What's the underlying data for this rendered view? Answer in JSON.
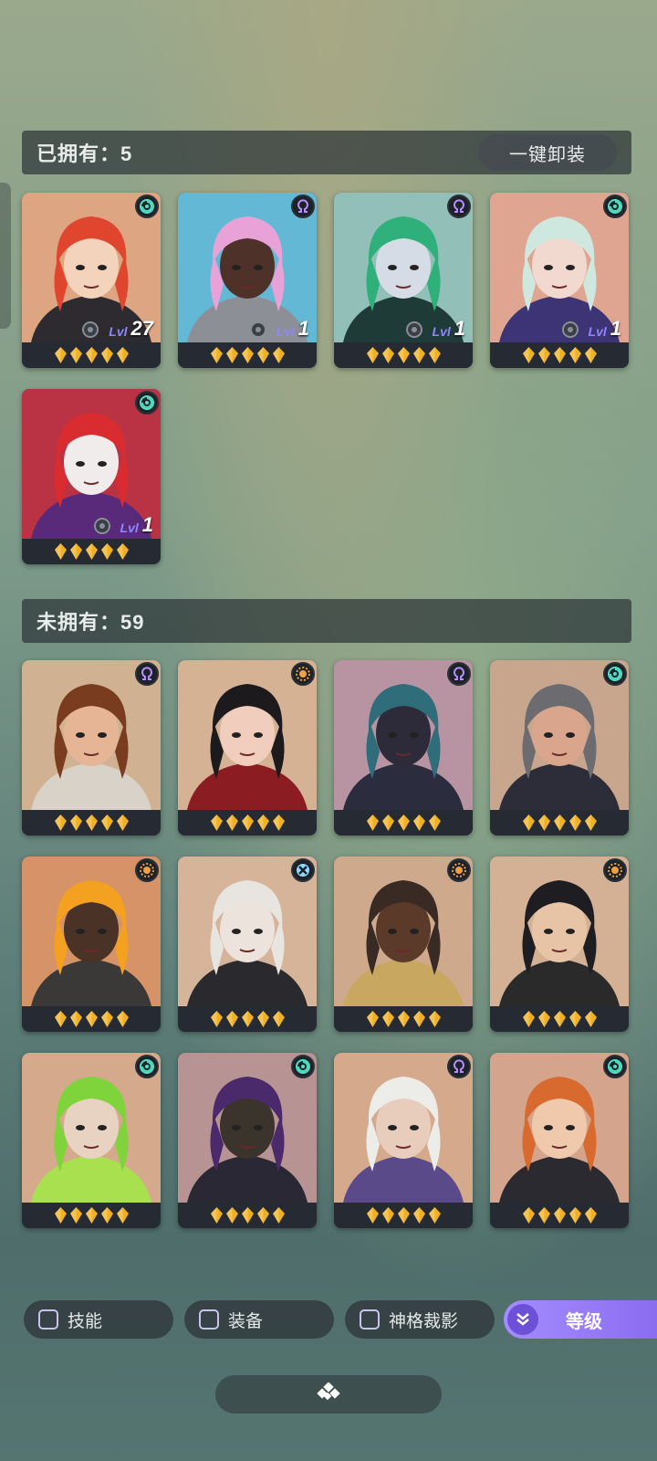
{
  "owned": {
    "title": "已拥有：5",
    "unequip_all": "一键卸装",
    "heroes": [
      {
        "name_icon": "red-hair-hero-portrait",
        "bg": "#f0b48e",
        "hair": "#e0452e",
        "skin": "#f4d3bc",
        "outfit": "#2d2a30",
        "class_icon": "swirl-icon",
        "class_color": "#4fe0c3",
        "lv_tag": "Lvl",
        "level": "27",
        "stars": 5
      },
      {
        "name_icon": "pink-hair-hero-portrait",
        "bg": "#6cc8e8",
        "hair": "#e9a2d8",
        "skin": "#4e3128",
        "outfit": "#8c8f96",
        "class_icon": "omega-icon",
        "class_color": "#b88cff",
        "lv_tag": "Lvl",
        "level": "1",
        "stars": 5
      },
      {
        "name_icon": "green-hood-hero-portrait",
        "bg": "#9fd0c8",
        "hair": "#2fb07a",
        "skin": "#d6dce6",
        "outfit": "#1e3b38",
        "class_icon": "omega-icon",
        "class_color": "#b88cff",
        "lv_tag": "Lvl",
        "level": "1",
        "stars": 5
      },
      {
        "name_icon": "maid-hero-portrait",
        "bg": "#f2b39d",
        "hair": "#cfe8df",
        "skin": "#f2d9d0",
        "outfit": "#3c3475",
        "class_icon": "swirl-icon",
        "class_color": "#4fe0c3",
        "lv_tag": "Lvl",
        "level": "1",
        "stars": 5
      },
      {
        "name_icon": "jester-hero-portrait",
        "bg": "#c9384a",
        "hair": "#d92c30",
        "skin": "#f1ecec",
        "outfit": "#5a2a7a",
        "class_icon": "swirl-icon",
        "class_color": "#4fe0c3",
        "lv_tag": "Lvl",
        "level": "1",
        "stars": 5
      }
    ]
  },
  "unowned": {
    "title": "未拥有：59",
    "heroes": [
      {
        "name_icon": "bearded-hero-portrait",
        "bg": "#e2c2a0",
        "hair": "#7a3c1e",
        "skin": "#e6b595",
        "outfit": "#d8d2c8",
        "class_icon": "omega-icon",
        "class_color": "#b88cff",
        "stars": 5
      },
      {
        "name_icon": "dark-queen-hero-portrait",
        "bg": "#e9c2a2",
        "hair": "#1c1a1c",
        "skin": "#f0cdbd",
        "outfit": "#8a1c22",
        "class_icon": "sun-icon",
        "class_color": "#f0a040",
        "stars": 5
      },
      {
        "name_icon": "goggles-hero-portrait",
        "bg": "#c8a0b0",
        "hair": "#2f6d7a",
        "skin": "#2d2b3a",
        "outfit": "#2b2d3e",
        "class_icon": "omega-icon",
        "class_color": "#b88cff",
        "stars": 5
      },
      {
        "name_icon": "sword-hero-portrait",
        "bg": "#d9b39a",
        "hair": "#6b6b70",
        "skin": "#d9a68d",
        "outfit": "#2d2d3a",
        "class_icon": "swirl-icon",
        "class_color": "#4fe0c3",
        "stars": 5
      },
      {
        "name_icon": "flame-hero-portrait",
        "bg": "#e8a070",
        "hair": "#f4a020",
        "skin": "#4a3226",
        "outfit": "#3b3838",
        "class_icon": "sun-icon",
        "class_color": "#f0a040",
        "stars": 5
      },
      {
        "name_icon": "silver-lady-hero-portrait",
        "bg": "#e8c4a8",
        "hair": "#e8e4e0",
        "skin": "#ece3dc",
        "outfit": "#2a2a2e",
        "class_icon": "cross-icon",
        "class_color": "#8fd8ff",
        "stars": 5
      },
      {
        "name_icon": "masked-hero-portrait",
        "bg": "#e0b898",
        "hair": "#3a2a24",
        "skin": "#5b3a2a",
        "outfit": "#c8a860",
        "class_icon": "sun-icon",
        "class_color": "#f0a040",
        "stars": 5
      },
      {
        "name_icon": "spiky-hero-portrait",
        "bg": "#e6c0a2",
        "hair": "#1e1e22",
        "skin": "#e8c4a6",
        "outfit": "#2a2a2a",
        "class_icon": "sun-icon",
        "class_color": "#f0a040",
        "stars": 5
      },
      {
        "name_icon": "joker-hero-portrait",
        "bg": "#e8b898",
        "hair": "#7ed43a",
        "skin": "#e8d2c2",
        "outfit": "#a8e050",
        "class_icon": "swirl-icon",
        "class_color": "#4fe0c3",
        "stars": 5
      },
      {
        "name_icon": "hooded-hero-portrait",
        "bg": "#c8a0a0",
        "hair": "#4a2a6a",
        "skin": "#3a342c",
        "outfit": "#2a2834",
        "class_icon": "swirl-icon",
        "class_color": "#4fe0c3",
        "stars": 5
      },
      {
        "name_icon": "white-curl-hero-portrait",
        "bg": "#e8b898",
        "hair": "#ecece8",
        "skin": "#e8cdbd",
        "outfit": "#5a4a8a",
        "class_icon": "omega-icon",
        "class_color": "#b88cff",
        "stars": 5
      },
      {
        "name_icon": "braid-hero-portrait",
        "bg": "#e6b498",
        "hair": "#d86a30",
        "skin": "#f0c8ac",
        "outfit": "#2a2a30",
        "class_icon": "swirl-icon",
        "class_color": "#4fe0c3",
        "stars": 5
      }
    ]
  },
  "filters": {
    "skill": "技能",
    "equipment": "装备",
    "divine": "神格裁影",
    "sort": "等级"
  },
  "colors": {
    "star": "#f0b020",
    "accent": "#8a6df0"
  }
}
